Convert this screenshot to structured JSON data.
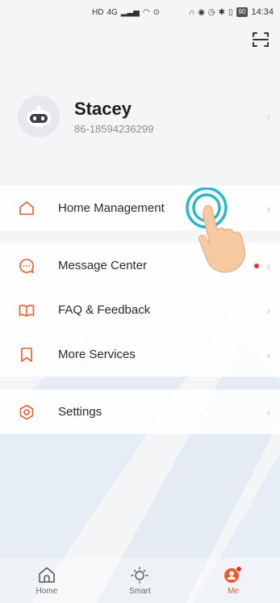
{
  "status_bar": {
    "left_icons": [
      "HD",
      "4G",
      "signal",
      "wifi",
      "location"
    ],
    "right_icons": [
      "headset",
      "eye",
      "alarm",
      "bluetooth",
      "vibrate"
    ],
    "battery": "90",
    "time": "14:34"
  },
  "profile": {
    "name": "Stacey",
    "phone": "86-18594236299"
  },
  "menu": {
    "group1": [
      {
        "label": "Home Management",
        "icon": "house-icon"
      }
    ],
    "group2": [
      {
        "label": "Message Center",
        "icon": "chat-bubble-icon",
        "badge": true
      },
      {
        "label": "FAQ & Feedback",
        "icon": "book-icon"
      },
      {
        "label": "More Services",
        "icon": "bookmark-icon"
      }
    ],
    "group3": [
      {
        "label": "Settings",
        "icon": "settings-hexagon-icon"
      }
    ]
  },
  "tabs": [
    {
      "label": "Home",
      "icon": "home-icon",
      "active": false
    },
    {
      "label": "Smart",
      "icon": "sun-icon",
      "active": false
    },
    {
      "label": "Me",
      "icon": "profile-icon",
      "active": true
    }
  ],
  "colors": {
    "accent": "#f05a2b",
    "touch_ring": "#29b8c5"
  }
}
